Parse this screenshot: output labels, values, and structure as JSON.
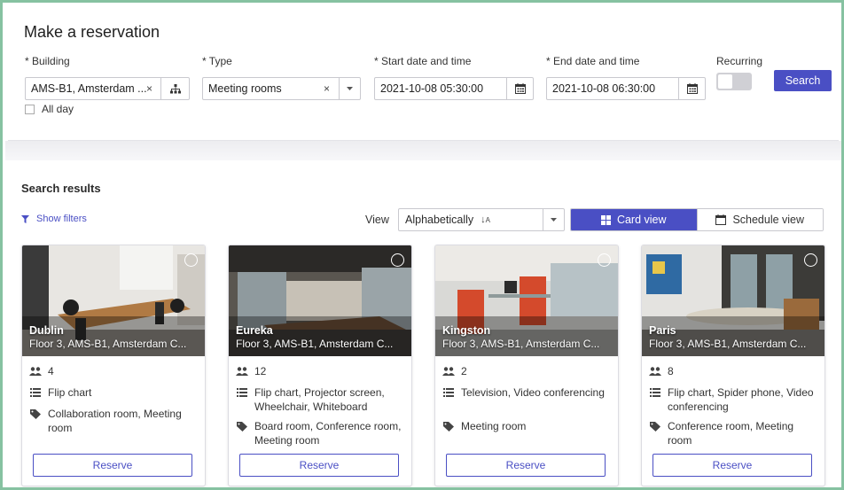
{
  "page": {
    "title": "Make a reservation"
  },
  "form": {
    "building": {
      "label": "* Building",
      "value": "AMS-B1, Amsterdam ..."
    },
    "type": {
      "label": "* Type",
      "value": "Meeting rooms"
    },
    "start": {
      "label": "* Start date and time",
      "value": "2021-10-08 05:30:00"
    },
    "end": {
      "label": "* End date and time",
      "value": "2021-10-08 06:30:00"
    },
    "recurring": {
      "label": "Recurring",
      "on": false
    },
    "search_label": "Search",
    "all_day_label": "All day"
  },
  "results": {
    "title": "Search results",
    "show_filters": "Show filters",
    "view_label": "View",
    "sort_value": "Alphabetically",
    "card_view": "Card view",
    "schedule_view": "Schedule view"
  },
  "rooms": [
    {
      "name": "Dublin",
      "location": "Floor 3, AMS-B1, Amsterdam C...",
      "capacity": "4",
      "equipment": "Flip chart",
      "tags": "Collaboration room, Meeting room",
      "reserve": "Reserve"
    },
    {
      "name": "Eureka",
      "location": "Floor 3, AMS-B1, Amsterdam C...",
      "capacity": "12",
      "equipment": "Flip chart, Projector screen, Wheelchair, Whiteboard",
      "tags": "Board room, Conference room, Meeting room",
      "reserve": "Reserve"
    },
    {
      "name": "Kingston",
      "location": "Floor 3, AMS-B1, Amsterdam C...",
      "capacity": "2",
      "equipment": "Television, Video conferencing",
      "tags": "Meeting room",
      "reserve": "Reserve"
    },
    {
      "name": "Paris",
      "location": "Floor 3, AMS-B1, Amsterdam C...",
      "capacity": "8",
      "equipment": "Flip chart, Spider phone, Video conferencing",
      "tags": "Conference room, Meeting room",
      "reserve": "Reserve"
    }
  ],
  "colors": {
    "accent": "#4a4fc4",
    "frame": "#86c2a1"
  },
  "icons": {
    "building": "hierarchy-icon",
    "calendar": "calendar-icon",
    "filter": "filter-icon",
    "capacity": "people-icon",
    "equipment": "list-icon",
    "tags": "tag-icon"
  }
}
